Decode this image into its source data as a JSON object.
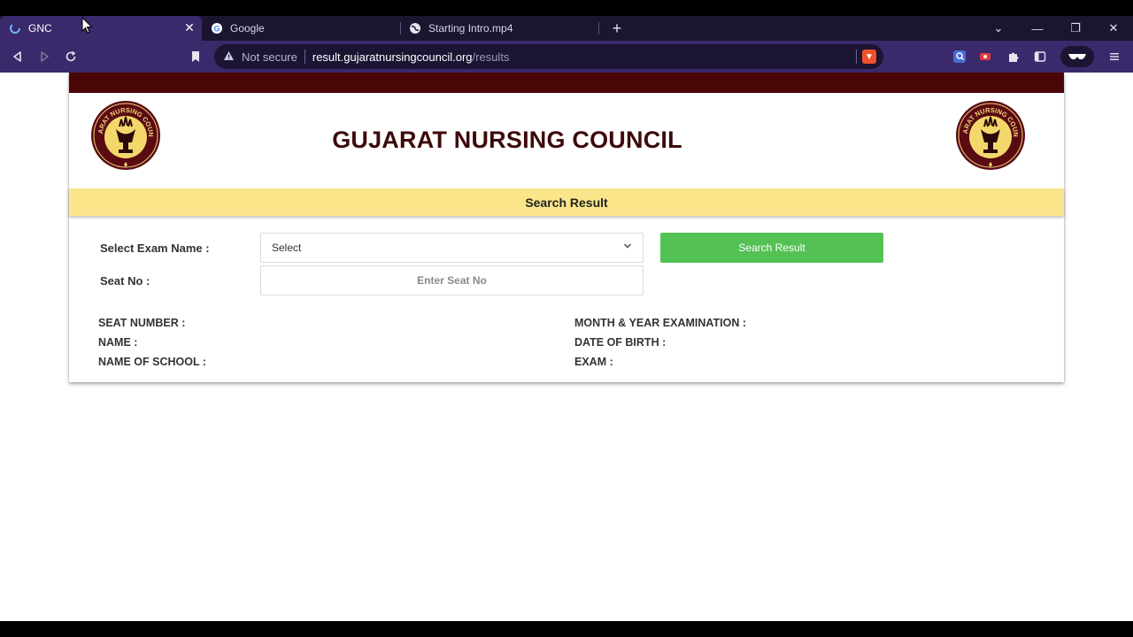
{
  "browser": {
    "tabs": [
      {
        "title": "GNC",
        "active": true,
        "favicon": "gnc-loading-icon"
      },
      {
        "title": "Google",
        "active": false,
        "favicon": "google-icon"
      },
      {
        "title": "Starting Intro.mp4",
        "active": false,
        "favicon": "globe-icon"
      }
    ],
    "new_tab": "+",
    "window_controls": {
      "dropdown": "⌄",
      "minimize": "—",
      "restore": "❐",
      "close": "✕"
    },
    "address": {
      "security_label": "Not secure",
      "host": "result.gujaratnursingcouncil.org",
      "path": "/results"
    },
    "colors": {
      "tab_bar": "#1b1530",
      "toolbar": "#3a2a6b",
      "omnibox": "#1c1433"
    }
  },
  "page": {
    "site_title": "GUJARAT NURSING COUNCIL",
    "logo_text": "GUJARAT NURSING COUNCIL",
    "band_title": "Search Result",
    "form": {
      "exam_label": "Select Exam Name :",
      "exam_selected": "Select",
      "seat_label": "Seat No :",
      "seat_placeholder": "Enter Seat No",
      "search_button": "Search Result"
    },
    "result_fields": {
      "left": [
        "SEAT NUMBER :",
        "NAME :",
        "NAME OF SCHOOL :"
      ],
      "right": [
        "MONTH & YEAR EXAMINATION :",
        "DATE OF BIRTH :",
        "EXAM :"
      ]
    },
    "colors": {
      "maroon": "#4a0507",
      "band": "#fbe58a",
      "button": "#54c154",
      "title": "#3d0a0c"
    }
  }
}
